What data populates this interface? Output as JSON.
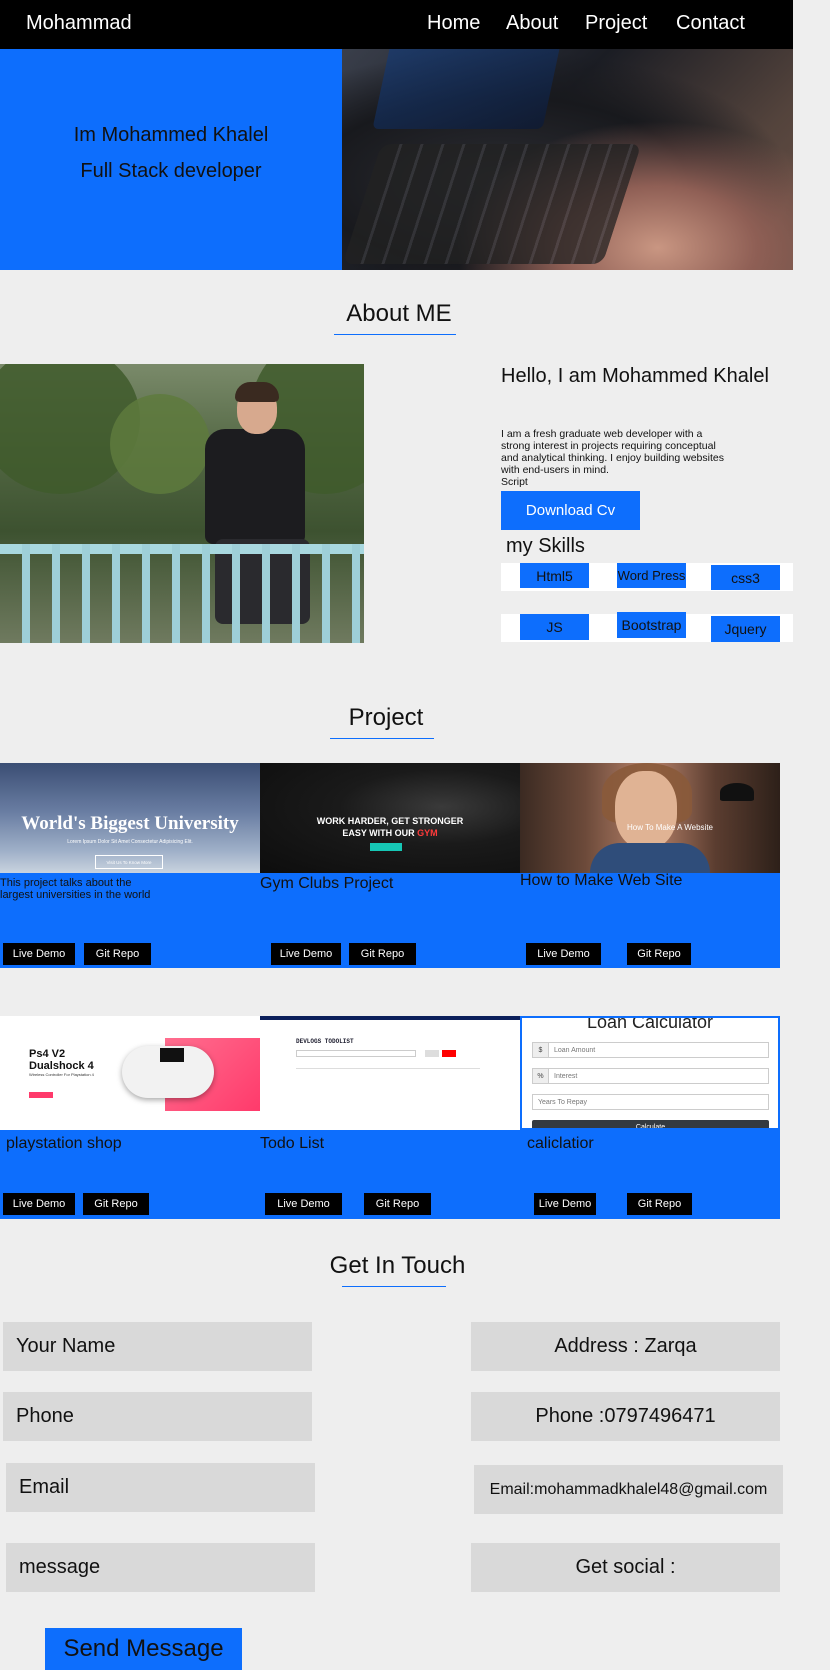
{
  "nav": {
    "brand": "Mohammad",
    "links": [
      "Home",
      "About",
      "Project",
      "Contact"
    ]
  },
  "hero": {
    "line1": "Im Mohammed Khalel",
    "line2": "Full Stack developer"
  },
  "about": {
    "section_title": "About  ME",
    "heading": "Hello, I am Mohammed Khalel",
    "text": "I am a fresh graduate web developer with a strong interest in projects requiring conceptual and analytical thinking. I enjoy building websites with end-users in mind.",
    "script": "Script",
    "download_label": "Download  Cv",
    "skills_title": "my Skills",
    "skills": [
      "Html5",
      "Word Press",
      "css3",
      "JS",
      "Bootstrap",
      "Jquery"
    ]
  },
  "projects": {
    "section_title": "Project",
    "cards": [
      {
        "desc": "This project talks about the largest universities in the world",
        "thumb_title": "World's Biggest University",
        "thumb_sub": "Lorem Ipsum Dolor Sit Amet Consectetur Adipisicing Elit.",
        "thumb_btn": "Visit Us To Know More",
        "live_label": "Live Demo",
        "repo_label": "Git Repo"
      },
      {
        "desc": "Gym Clubs Project",
        "thumb_title_a": "WORK HARDER, GET STRONGER",
        "thumb_title_b": "EASY WITH OUR",
        "thumb_title_c": "GYM",
        "live_label": "Live Demo",
        "repo_label": "Git Repo"
      },
      {
        "desc": "How to Make Web Site",
        "thumb_label": "How To Make A Website",
        "live_label": "Live Demo",
        "repo_label": "Git Repo"
      },
      {
        "desc": "playstation shop",
        "thumb_title": "Ps4 V2 Dualshock 4",
        "thumb_sub": "Wireless Controller For Playstation 4",
        "live_label": "Live Demo",
        "repo_label": "Git Repo"
      },
      {
        "desc": "Todo List",
        "thumb_title": "DEVLOGS TODOLIST",
        "live_label": "Live Demo",
        "repo_label": "Git Repo"
      },
      {
        "desc": "caliclatior",
        "thumb_title": "Loan Calculator",
        "fields": [
          {
            "prefix": "$",
            "placeholder": "Loan Amount"
          },
          {
            "prefix": "%",
            "placeholder": "Interest"
          },
          {
            "prefix": "",
            "placeholder": "Years To Repay"
          }
        ],
        "calc_label": "Calculate",
        "live_label": "Live Demo",
        "repo_label": "Git Repo"
      }
    ]
  },
  "contact": {
    "section_title": "Get In Touch",
    "name_placeholder": "Your Name",
    "phone_placeholder": "Phone",
    "email_placeholder": "Email",
    "message_placeholder": "message",
    "address": "Address : Zarqa",
    "phone_info": "Phone :0797496471",
    "email_info": "Email:mohammadkhalel48@gmail.com",
    "social": "Get social :",
    "send_label": "Send Message"
  },
  "colors": {
    "accent": "#0d6efd",
    "nav_bg": "#000000",
    "page_bg": "#eeeeee",
    "field_bg": "#d9d9d9"
  }
}
